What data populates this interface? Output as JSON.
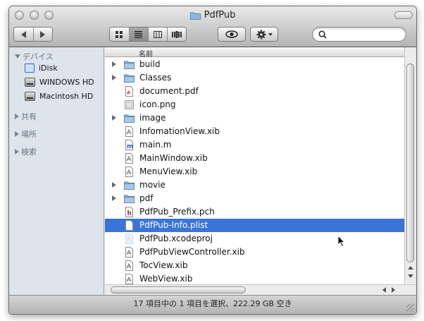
{
  "window": {
    "title": "PdfPub"
  },
  "toolbar": {
    "view_modes": [
      "icon-view",
      "list-view",
      "column-view",
      "coverflow-view"
    ],
    "active_view": "list-view",
    "search_placeholder": ""
  },
  "sidebar": {
    "devices_header": "デバイス",
    "devices": [
      {
        "label": "iDisk",
        "icon": "idisk-icon"
      },
      {
        "label": "WINDOWS HD",
        "icon": "hard-drive-icon"
      },
      {
        "label": "Macintosh HD",
        "icon": "hard-drive-icon"
      }
    ],
    "shared_header": "共有",
    "places_header": "場所",
    "search_header": "検索"
  },
  "list": {
    "column_name": "名前",
    "selected_index": 12,
    "items": [
      {
        "name": "build",
        "kind": "folder",
        "expandable": true
      },
      {
        "name": "Classes",
        "kind": "folder",
        "expandable": true
      },
      {
        "name": "document.pdf",
        "kind": "pdf",
        "expandable": false
      },
      {
        "name": "icon.png",
        "kind": "image",
        "expandable": false
      },
      {
        "name": "image",
        "kind": "folder",
        "expandable": true
      },
      {
        "name": "InfomationView.xib",
        "kind": "xib",
        "expandable": false
      },
      {
        "name": "main.m",
        "kind": "m",
        "expandable": false
      },
      {
        "name": "MainWindow.xib",
        "kind": "xib",
        "expandable": false
      },
      {
        "name": "MenuView.xib",
        "kind": "xib",
        "expandable": false
      },
      {
        "name": "movie",
        "kind": "folder",
        "expandable": true
      },
      {
        "name": "pdf",
        "kind": "folder",
        "expandable": true
      },
      {
        "name": "PdfPub_Prefix.pch",
        "kind": "h",
        "expandable": false
      },
      {
        "name": "PdfPub-Info.plist",
        "kind": "plist",
        "expandable": false
      },
      {
        "name": "PdfPub.xcodeproj",
        "kind": "xcodeproj",
        "expandable": false
      },
      {
        "name": "PdfPubViewController.xib",
        "kind": "xib",
        "expandable": false
      },
      {
        "name": "TocView.xib",
        "kind": "xib",
        "expandable": false
      },
      {
        "name": "WebView.xib",
        "kind": "xib",
        "expandable": false
      }
    ]
  },
  "status": {
    "text": "17 項目中の 1 項目を選択、222.29 GB 空き"
  },
  "colors": {
    "selection": "#3875d7",
    "sidebar_bg": "#dde4ec",
    "folder": "#8fb6de"
  }
}
